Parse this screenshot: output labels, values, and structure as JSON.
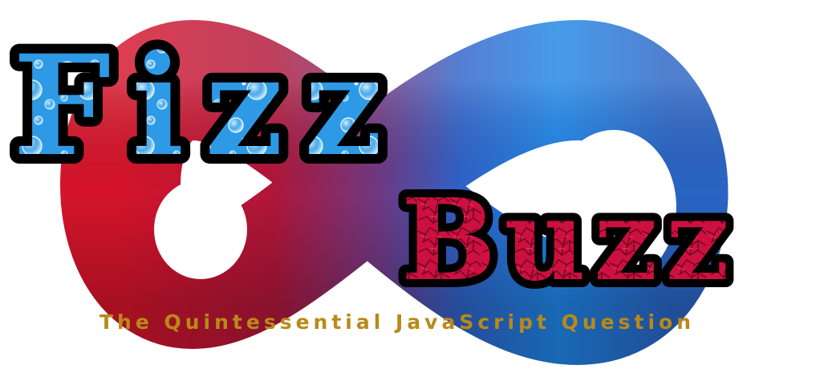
{
  "logo": {
    "word_1": "Fizz",
    "word_2": "Buzz",
    "tagline": "The Quintessential JavaScript Question"
  },
  "colors": {
    "loop_red": "#c8102e",
    "loop_red_dark": "#7a1530",
    "loop_purple": "#6a3a8a",
    "loop_blue": "#1e7ee0",
    "loop_blue_light": "#22a8f5",
    "fizz_fill": "#2f9be8",
    "buzz_fill": "#d0103c",
    "outline": "#000000",
    "tagline": "#b88a18"
  },
  "icons": {
    "background": "infinity-loop-icon"
  }
}
